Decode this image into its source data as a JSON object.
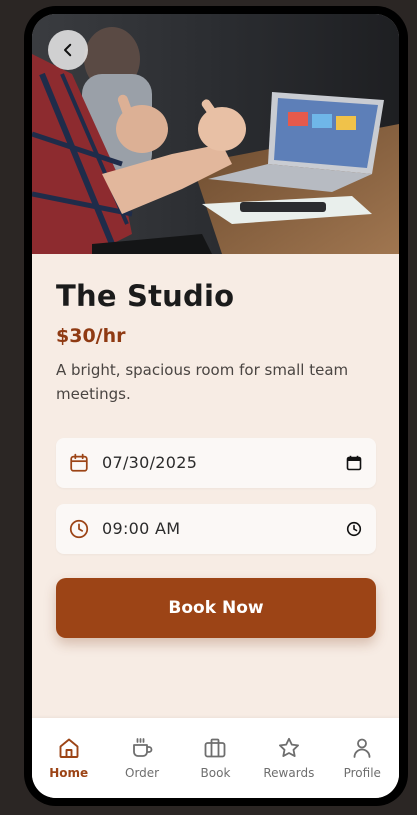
{
  "venue": {
    "title": "The Studio",
    "price": "$30/hr",
    "description": "A bright, spacious room for small team meetings."
  },
  "booking": {
    "date_value": "07/30/2025",
    "time_value": "09:00 AM",
    "book_label": "Book Now"
  },
  "nav": {
    "items": [
      {
        "label": "Home",
        "icon": "home-icon",
        "active": true
      },
      {
        "label": "Order",
        "icon": "coffee-cup-icon",
        "active": false
      },
      {
        "label": "Book",
        "icon": "briefcase-icon",
        "active": false
      },
      {
        "label": "Rewards",
        "icon": "star-icon",
        "active": false
      },
      {
        "label": "Profile",
        "icon": "user-icon",
        "active": false
      }
    ]
  },
  "colors": {
    "accent": "#9c4416",
    "price": "#8f3a13",
    "screen_background": "#f7ece4",
    "nav_inactive": "#6e6e6e"
  }
}
